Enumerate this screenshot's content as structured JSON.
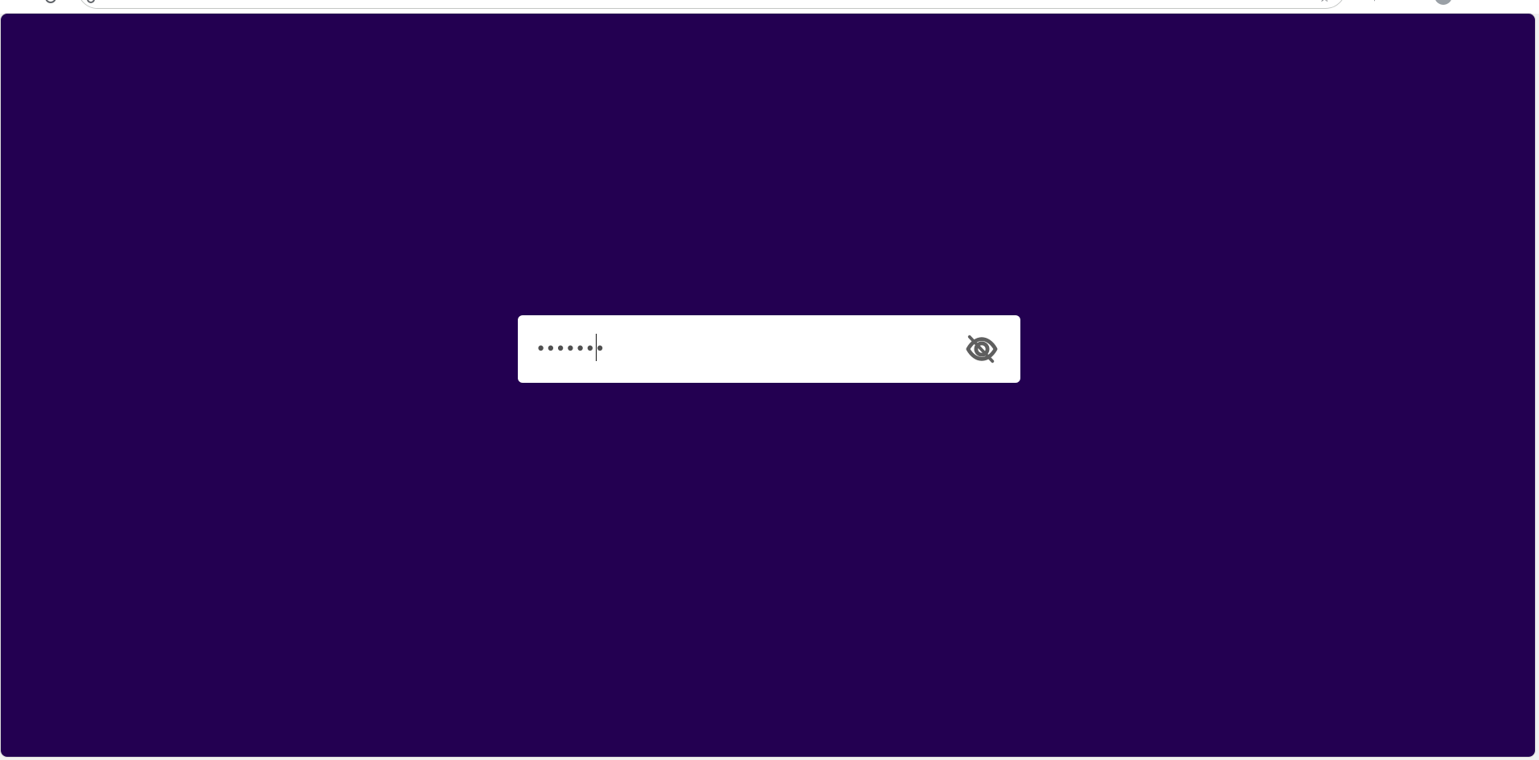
{
  "browser": {
    "reload_icon": "reload-icon",
    "bookmark_icon": "star-icon",
    "extension_icon": "puzzle-icon",
    "menu_icon": "menu-icon"
  },
  "page": {
    "background_color": "#230051"
  },
  "password_field": {
    "value": "•••••••",
    "input_type": "password",
    "placeholder": ""
  },
  "visibility_toggle": {
    "icon": "eye-slash-icon",
    "color": "#5f5f5f"
  }
}
